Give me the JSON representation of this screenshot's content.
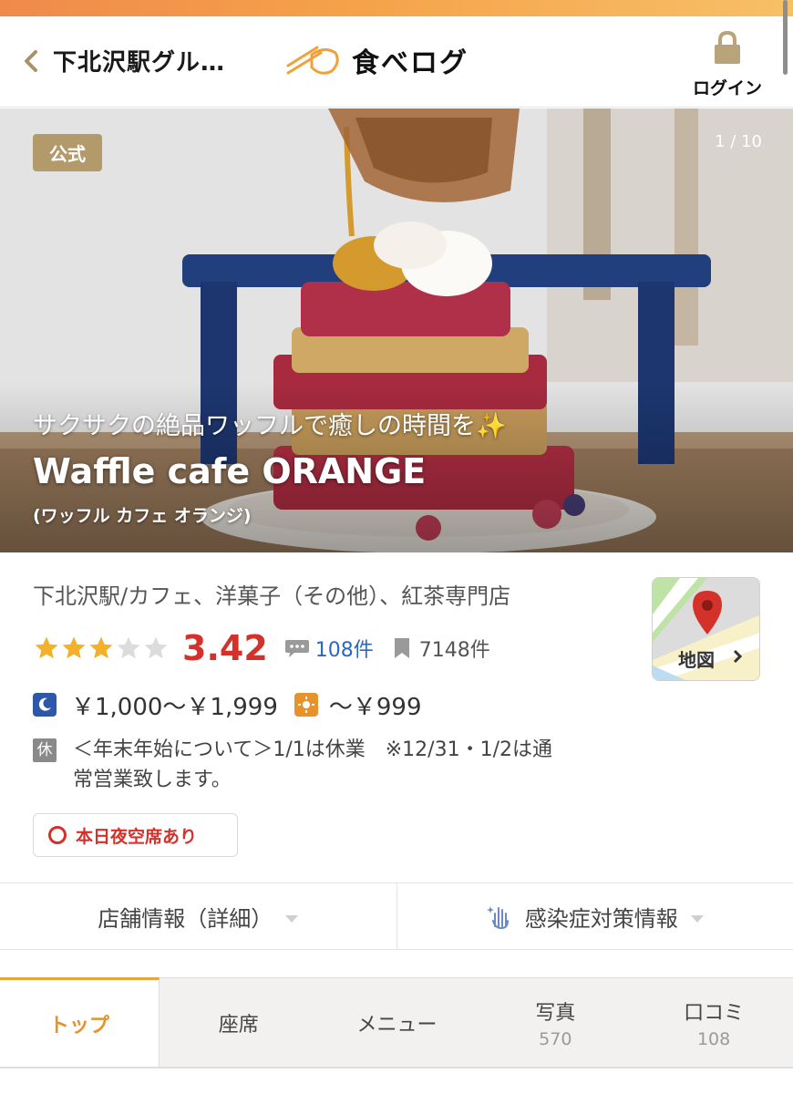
{
  "header": {
    "back_label": "下北沢駅グル…",
    "logo_text": "食べログ",
    "login_label": "ログイン"
  },
  "hero": {
    "badge": "公式",
    "counter": "1 / 10",
    "catchphrase": "サクサクの絶品ワッフルで癒しの時間を✨",
    "name": "Waffle cafe ORANGE",
    "kana": "(ワッフル カフェ オランジ)"
  },
  "restaurant": {
    "genre": "下北沢駅/カフェ、洋菓子（その他）、紅茶専門店",
    "stars_filled": 3,
    "stars_total": 5,
    "score": "3.42",
    "reviews": "108件",
    "saves": "7148件",
    "dinner_price": "￥1,000～￥1,999",
    "lunch_price": "～￥999",
    "holiday_icon": "休",
    "holiday_note_line1": "＜年末年始について＞1/1は休業　※12/31・1/2は通",
    "holiday_note_line2": "常営業致します。",
    "vacancy": "本日夜空席あり"
  },
  "map": {
    "label": "地図"
  },
  "info_bar": {
    "store_info": "店舗情報（詳細）",
    "infection": "感染症対策情報"
  },
  "tabs": [
    {
      "label": "トップ"
    },
    {
      "label": "座席"
    },
    {
      "label": "メニュー"
    },
    {
      "label": "写真",
      "count": "570"
    },
    {
      "label": "口コミ",
      "count": "108"
    }
  ],
  "colors": {
    "accent_orange": "#e8922b",
    "score_red": "#d4312a",
    "link_blue": "#2b68c4",
    "star_gold": "#f3b12b",
    "badge_gold": "#b39a6a"
  },
  "icons": [
    "chevron-left-icon",
    "chopsticks-icon",
    "lock-icon",
    "speech-bubble-icon",
    "bookmark-icon",
    "moon-icon",
    "sun-icon",
    "map-pin-icon",
    "chevron-right-icon",
    "hand-sparkle-icon",
    "caret-down-icon"
  ]
}
